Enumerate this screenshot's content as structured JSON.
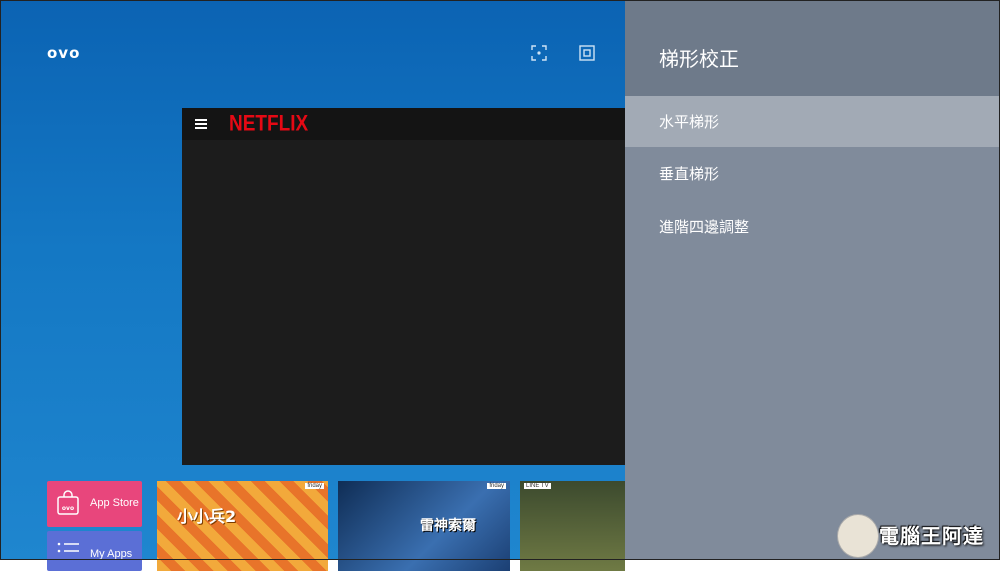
{
  "brand": {
    "logo_text": "ovo"
  },
  "top_icons": [
    "focus-icon",
    "screen-fit-icon"
  ],
  "player": {
    "app_name": "NETFLIX",
    "menu_icon": "hamburger-icon"
  },
  "apps_row": [
    {
      "label": "App Store",
      "icon": "ovo-bag-icon",
      "color": "#e8467c"
    },
    {
      "label": "My Apps",
      "icon": "list-icon",
      "color": "#5b6fd6"
    }
  ],
  "posters": [
    {
      "title": "小小兵2",
      "badge": "friday"
    },
    {
      "title": "雷神索爾",
      "badge": "friday"
    },
    {
      "title": "",
      "badge": "LINE TV"
    }
  ],
  "keystone_panel": {
    "title": "梯形校正",
    "items": [
      {
        "label": "水平梯形",
        "selected": true
      },
      {
        "label": "垂直梯形",
        "selected": false
      },
      {
        "label": "進階四邊調整",
        "selected": false
      }
    ]
  },
  "watermark": {
    "text": "電腦王阿達"
  },
  "colors": {
    "panel_bg": "#808b9b",
    "panel_selected": "#a2aab5",
    "netflix_red": "#e50914",
    "home_blue": "#0b63b3"
  }
}
